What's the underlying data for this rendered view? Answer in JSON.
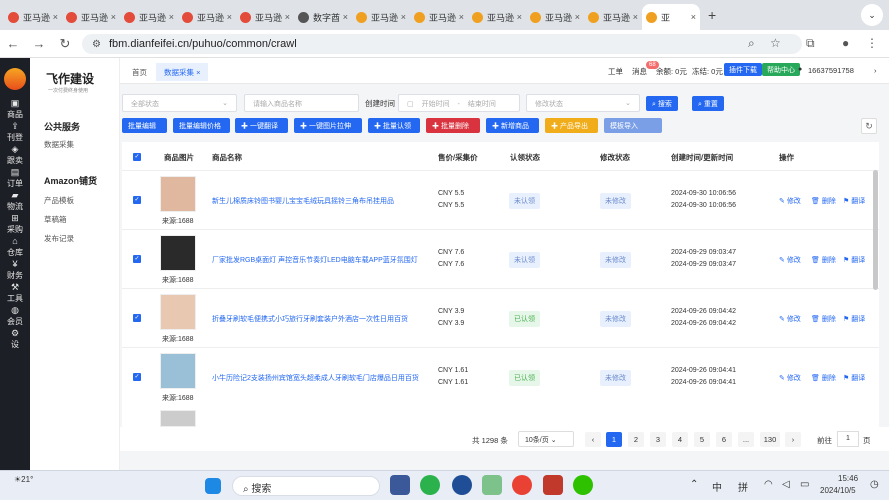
{
  "tabs": [
    {
      "label": "亚马逊",
      "color": "#e34b3b",
      "icon": "paw-icon"
    },
    {
      "label": "亚马逊",
      "color": "#e34b3b",
      "icon": "paw-icon"
    },
    {
      "label": "亚马逊",
      "color": "#e34b3b",
      "icon": "paw-icon"
    },
    {
      "label": "亚马逊",
      "color": "#e34b3b",
      "icon": "paw-icon"
    },
    {
      "label": "亚马逊",
      "color": "#e34b3b",
      "icon": "paw-icon"
    },
    {
      "label": "数字酋",
      "color": "#555555",
      "icon": "cloud-icon"
    },
    {
      "label": "亚马逊",
      "color": "#f0a020",
      "icon": "smile-icon"
    },
    {
      "label": "亚马逊",
      "color": "#f0a020",
      "icon": "smile-icon"
    },
    {
      "label": "亚马逊",
      "color": "#f0a020",
      "icon": "smile-icon"
    },
    {
      "label": "亚马逊",
      "color": "#f0a020",
      "icon": "smile-icon"
    },
    {
      "label": "亚马逊",
      "color": "#f0a020",
      "icon": "smile-icon"
    },
    {
      "label": "亚",
      "color": "#f0a020",
      "icon": "smile-icon"
    }
  ],
  "url": "fbm.dianfeifei.cn/puhuo/common/crawl",
  "sidebar": [
    {
      "label": "商品",
      "icon": "box-icon"
    },
    {
      "label": "刊登",
      "icon": "upload-icon"
    },
    {
      "label": "跟卖",
      "icon": "tag-icon"
    },
    {
      "label": "订单",
      "icon": "order-icon"
    },
    {
      "label": "物流",
      "icon": "truck-icon"
    },
    {
      "label": "采购",
      "icon": "cart-icon"
    },
    {
      "label": "仓库",
      "icon": "warehouse-icon"
    },
    {
      "label": "财务",
      "icon": "money-icon"
    },
    {
      "label": "工具",
      "icon": "tool-icon"
    },
    {
      "label": "会员",
      "icon": "user-icon"
    },
    {
      "label": "设",
      "icon": "settings-icon"
    }
  ],
  "brand": {
    "name": "飞作建设",
    "sub": "一次付费终身使用"
  },
  "menu": {
    "group1": "公共服务",
    "item1": "数据采集",
    "group2": "Amazon铺货",
    "items2": [
      "产品模板",
      "草稿箱",
      "发布记录"
    ]
  },
  "topnav": {
    "home": "首页",
    "current": "数据采集",
    "close": "×",
    "ticket": "工单",
    "msg": "消息",
    "msg_count": "68",
    "balance": "余额: 0元",
    "frozen": "冻结: 0元",
    "plugin": "插件下载",
    "help": "帮助中心",
    "phone": "16637591758"
  },
  "filters": {
    "status_placeholder": "全部状态",
    "name_placeholder": "请输入商品名称",
    "time_label": "创建时间",
    "start": "开始时间",
    "sep": "-",
    "end": "结束时间",
    "modify_placeholder": "修改状态",
    "search": "搜索",
    "reset": "重置"
  },
  "actions": [
    {
      "label": "批量编辑",
      "color": "#2468f2"
    },
    {
      "label": "批量编辑价格",
      "color": "#2468f2"
    },
    {
      "label": "一键翻译",
      "color": "#2468f2"
    },
    {
      "label": "一键图片拉伸",
      "color": "#2468f2"
    },
    {
      "label": "批量认领",
      "color": "#2468f2"
    },
    {
      "label": "批量删除",
      "color": "#d9333f"
    },
    {
      "label": "新增商品",
      "color": "#2468f2"
    },
    {
      "label": "产品导出",
      "color": "#f0ad19"
    },
    {
      "label": "模板导入",
      "color": "#7b9fe6"
    }
  ],
  "headers": [
    "商品图片",
    "商品名称",
    "售价/采集价",
    "认领状态",
    "修改状态",
    "创建时间/更新时间",
    "操作"
  ],
  "rows": [
    {
      "source": "来源:1688",
      "name": "新生儿棉质床铃图书婴儿宝宝毛绒玩具摇铃三角布吊挂用品",
      "price1": "CNY 5.5",
      "price2": "CNY 5.5",
      "claim": "未认领",
      "claim_color": "blue",
      "modify": "未修改",
      "t1": "2024-09-30 10:06:56",
      "t2": "2024-09-30 10:06:56",
      "img": "#e0b8a0"
    },
    {
      "source": "来源:1688",
      "name": "厂家批发RGB桌面灯 声控音乐节奏灯LED电脑车载APP蓝牙氛围灯",
      "price1": "CNY 7.6",
      "price2": "CNY 7.6",
      "claim": "未认领",
      "claim_color": "blue",
      "modify": "未修改",
      "t1": "2024-09-29 09:03:47",
      "t2": "2024-09-29 09:03:47",
      "img": "#2a2a2a"
    },
    {
      "source": "来源:1688",
      "name": "折叠牙刷软毛便携式小巧旅行牙刷套装户外酒店一次性日用百货",
      "price1": "CNY 3.9",
      "price2": "CNY 3.9",
      "claim": "已认领",
      "claim_color": "green",
      "modify": "未修改",
      "t1": "2024-09-26 09:04:42",
      "t2": "2024-09-26 09:04:42",
      "img": "#e8c8b0"
    },
    {
      "source": "来源:1688",
      "name": "小牛历险记2支装扬州宾馆宽头超柔成人牙刷软毛门店爆品日用百货",
      "price1": "CNY 1.61",
      "price2": "CNY 1.61",
      "claim": "已认领",
      "claim_color": "green",
      "modify": "未修改",
      "t1": "2024-09-26 09:04:41",
      "t2": "2024-09-26 09:04:41",
      "img": "#9ac0d8"
    }
  ],
  "ops": {
    "edit": "修改",
    "del": "删除",
    "trans": "翻译"
  },
  "pager": {
    "total": "共 1298 条",
    "size": "10条/页",
    "pages": [
      "1",
      "2",
      "3",
      "4",
      "5",
      "6",
      "...",
      "130"
    ],
    "goto": "前往",
    "page_val": "1",
    "page_unit": "页"
  },
  "taskbar": {
    "weather": "21°",
    "search": "搜索",
    "ime1": "中",
    "ime2": "拼",
    "time": "15:46",
    "date": "2024/10/5"
  }
}
